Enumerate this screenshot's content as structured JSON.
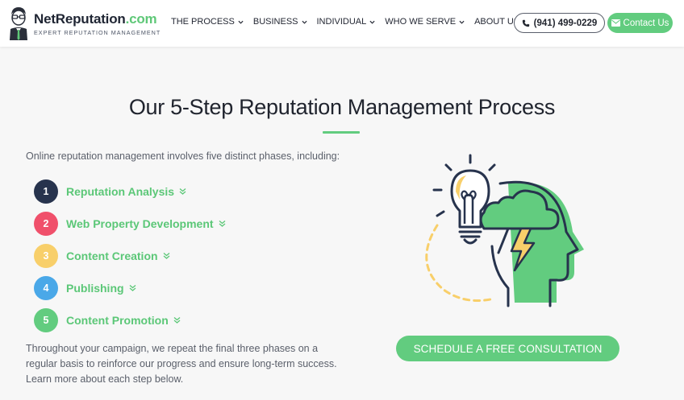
{
  "header": {
    "logo": {
      "name_main": "NetReputation",
      "name_tld": ".com",
      "tagline": "EXPERT REPUTATION MANAGEMENT"
    },
    "nav": [
      {
        "label": "THE PROCESS",
        "icon": "chevron-down-icon"
      },
      {
        "label": "BUSINESS",
        "icon": "chevron-down-icon"
      },
      {
        "label": "INDIVIDUAL",
        "icon": "chevron-down-icon"
      },
      {
        "label": "WHO WE SERVE",
        "icon": "chevron-down-icon"
      },
      {
        "label": "ABOUT US",
        "icon": "chevron-down-icon"
      }
    ],
    "phone": {
      "label": "(941) 499-0229",
      "icon": "phone-icon"
    },
    "contact": {
      "label": "Contact Us",
      "icon": "envelope-icon"
    }
  },
  "main": {
    "title": "Our 5-Step Reputation Management Process",
    "intro": "Online reputation management involves five distinct phases, including:",
    "steps": [
      {
        "number": "1",
        "label": "Reputation Analysis",
        "color": "#27334d"
      },
      {
        "number": "2",
        "label": "Web Property Development",
        "color": "#f0506b"
      },
      {
        "number": "3",
        "label": "Content Creation",
        "color": "#f8cf6a"
      },
      {
        "number": "4",
        "label": "Publishing",
        "color": "#4aa8e8"
      },
      {
        "number": "5",
        "label": "Content Promotion",
        "color": "#62cc7f"
      }
    ],
    "outro": "Throughout your campaign, we repeat the final three phases on a regular basis to reinforce our progress and ensure long-term success. Learn more about each step below.",
    "cta_label": "SCHEDULE A FREE CONSULTATION"
  },
  "colors": {
    "accent": "#62cc7f",
    "dark": "#27334d",
    "yellow": "#f8cf6a"
  }
}
